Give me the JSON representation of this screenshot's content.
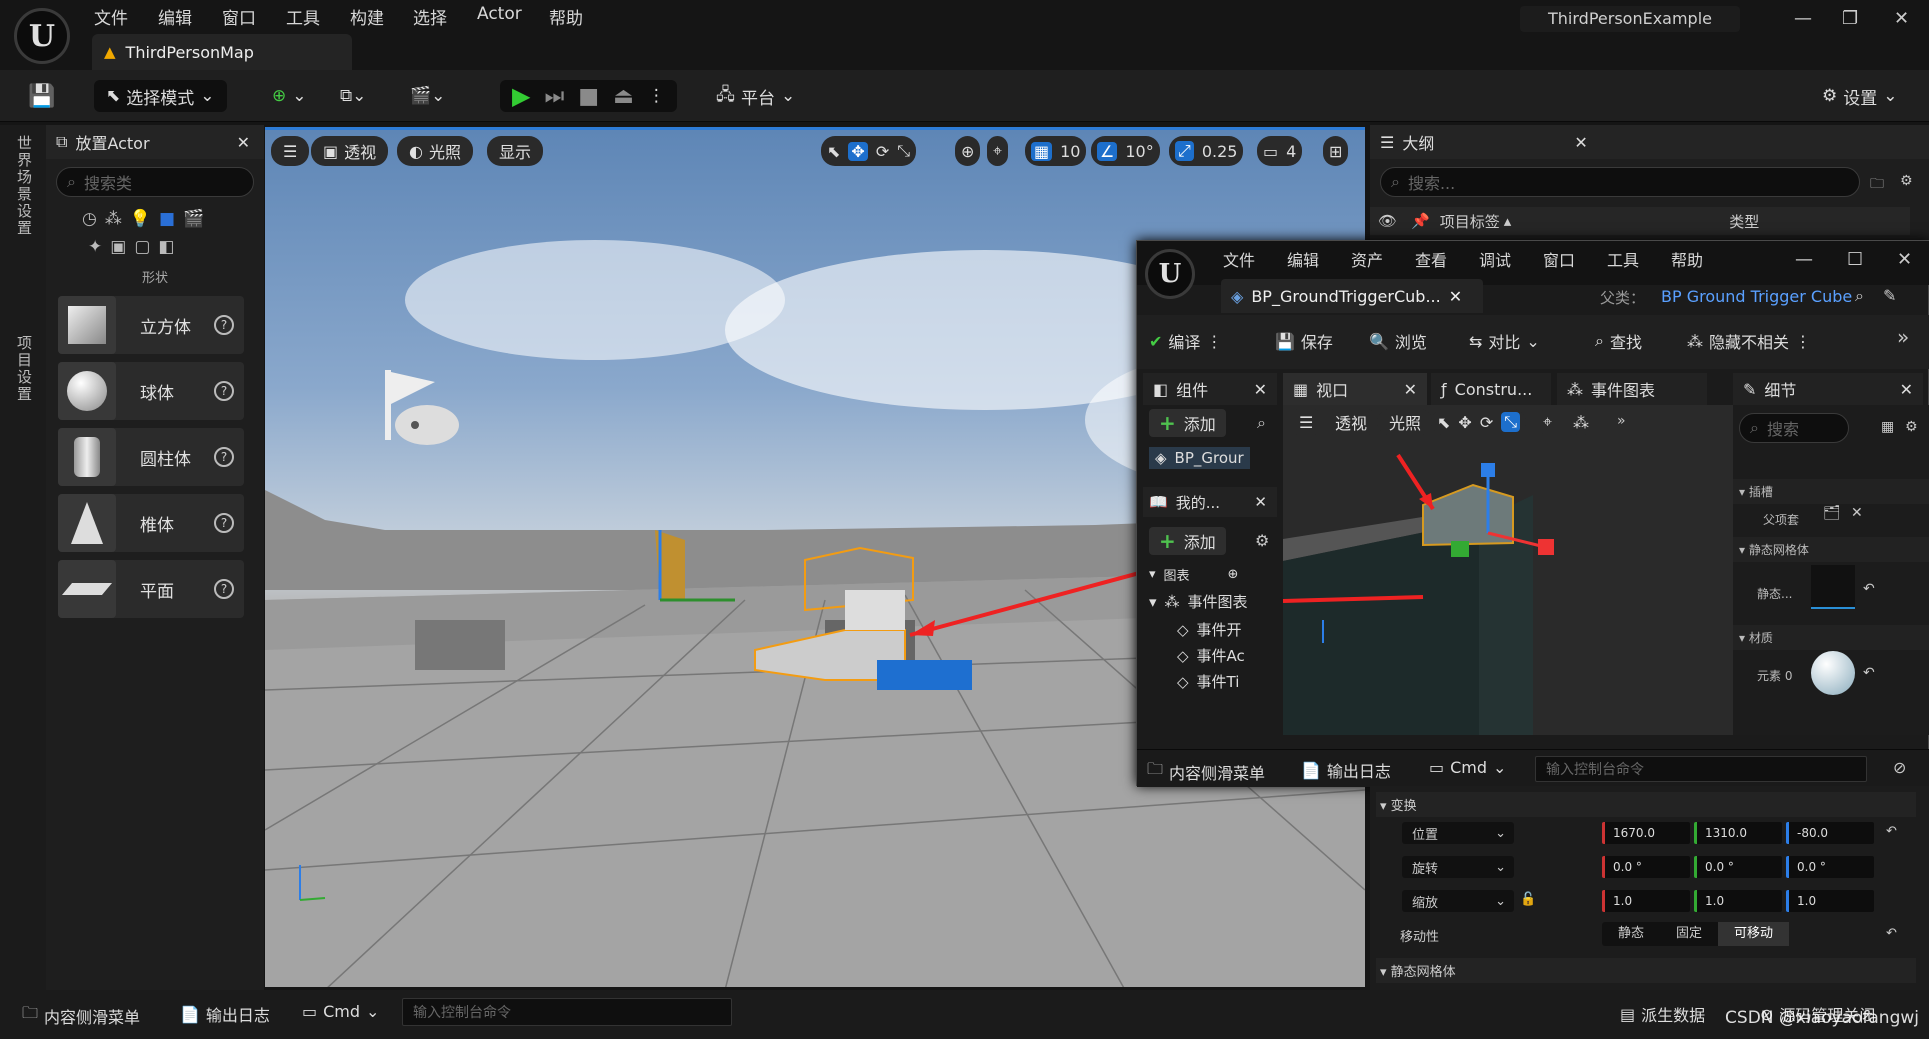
{
  "app": {
    "menu": [
      "文件",
      "编辑",
      "窗口",
      "工具",
      "构建",
      "选择",
      "Actor",
      "帮助"
    ],
    "project": "ThirdPersonExample",
    "map_tab": "ThirdPersonMap"
  },
  "toolbar": {
    "mode": "选择模式",
    "platform": "平台",
    "settings": "设置"
  },
  "left_strip": {
    "world_settings": "世界场景设置",
    "project_settings": "项目设置"
  },
  "place_actor": {
    "title": "放置Actor",
    "search_placeholder": "搜索类",
    "category": "形状",
    "shapes": [
      {
        "label": "立方体"
      },
      {
        "label": "球体"
      },
      {
        "label": "圆柱体"
      },
      {
        "label": "椎体"
      },
      {
        "label": "平面"
      }
    ]
  },
  "viewport": {
    "perspective": "透视",
    "lit": "光照",
    "show": "显示",
    "grid": "10",
    "angle": "10°",
    "scale": "0.25",
    "camera_speed": "4"
  },
  "outliner": {
    "title": "大纲",
    "search_placeholder": "搜索...",
    "col_label": "项目标签",
    "col_type": "类型"
  },
  "bp_editor": {
    "menu": [
      "文件",
      "编辑",
      "资产",
      "查看",
      "调试",
      "窗口",
      "工具",
      "帮助"
    ],
    "tab": "BP_GroundTriggerCub...",
    "parent_label": "父类：",
    "parent_class": "BP Ground Trigger Cube",
    "toolbar": [
      "编译",
      "保存",
      "浏览",
      "对比",
      "查找",
      "隐藏不相关"
    ],
    "tabs": {
      "components": "组件",
      "viewport": "视口",
      "construct": "Constru...",
      "event_graph": "事件图表",
      "details": "细节"
    },
    "add": "添加",
    "component_item": "BP_Grour",
    "my_bp": "我的...",
    "graph_label": "图表",
    "event_graph_item": "事件图表",
    "events": [
      "事件开",
      "事件Ac",
      "事件Ti"
    ],
    "vp_perspective": "透视",
    "vp_lit": "光照",
    "details_search": "搜索",
    "sockets": "插槽",
    "parent_socket": "父项套",
    "static_mesh": "静态网格体",
    "static_mesh_short": "静态...",
    "materials": "材质",
    "element0": "元素 0",
    "content_drawer": "内容侧滑菜单",
    "output_log": "输出日志",
    "cmd": "Cmd",
    "cmd_placeholder": "输入控制台命令"
  },
  "transform": {
    "title": "变换",
    "location": "位置",
    "rotation": "旋转",
    "scale": "缩放",
    "loc_values": [
      "1670.0",
      "1310.0",
      "-80.0"
    ],
    "rot_values": [
      "0.0 °",
      "0.0 °",
      "0.0 °"
    ],
    "scale_values": [
      "1.0",
      "1.0",
      "1.0"
    ],
    "mobility": "移动性",
    "mob_options": [
      "静态",
      "固定",
      "可移动"
    ],
    "static_mesh": "静态网格体"
  },
  "statusbar": {
    "content_drawer": "内容侧滑菜单",
    "output_log": "输出日志",
    "cmd": "Cmd",
    "cmd_placeholder": "输入控制台命令",
    "derived": "派生数据",
    "source_control": "源码管理关闭"
  },
  "watermark": "CSDN @xiaoyaofangwj"
}
